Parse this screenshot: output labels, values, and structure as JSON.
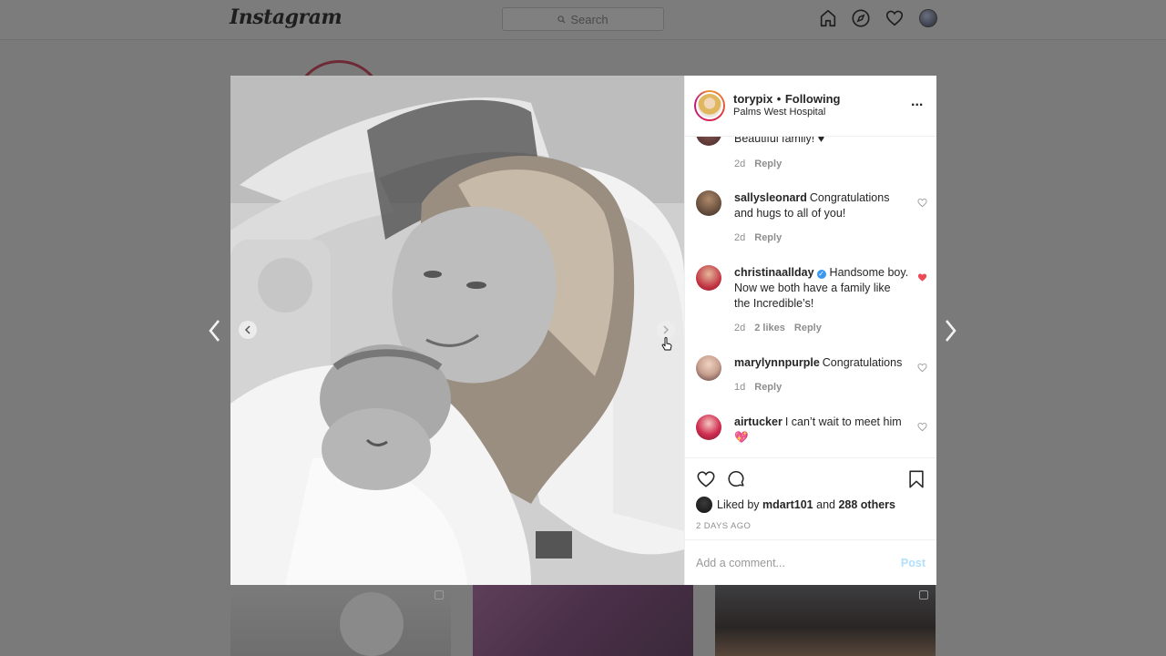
{
  "topbar": {
    "logo": "Instagram",
    "search_placeholder": "Search",
    "icons": [
      "home-icon",
      "explore-compass-icon",
      "activity-heart-icon",
      "profile-avatar"
    ]
  },
  "post": {
    "header": {
      "username": "torypix",
      "separator": "•",
      "follow_status": "Following",
      "location": "Palms West Hospital"
    },
    "comments": [
      {
        "username": "",
        "text": "Beautiful family! ♥",
        "age": "2d",
        "likes": "",
        "reply": "Reply",
        "liked": false
      },
      {
        "username": "sallysleonard",
        "text": "Congratulations and hugs to all of you!",
        "age": "2d",
        "likes": "",
        "reply": "Reply",
        "liked": false
      },
      {
        "username": "christinaallday",
        "verified": true,
        "text": "Handsome boy. Now we both have a family like the Incredible’s!",
        "age": "2d",
        "likes": "2 likes",
        "reply": "Reply",
        "liked": true
      },
      {
        "username": "marylynnpurple",
        "text": "Congratulations",
        "age": "1d",
        "likes": "",
        "reply": "Reply",
        "liked": false
      },
      {
        "username": "airtucker",
        "text": "I can’t wait to meet him 💖",
        "age": "",
        "likes": "",
        "reply": "",
        "liked": false
      }
    ],
    "likes": {
      "prefix": "Liked by",
      "user": "mdart101",
      "conjunction": "and",
      "others": "288 others"
    },
    "timestamp": "2 DAYS AGO",
    "add_comment": {
      "placeholder": "Add a comment...",
      "post_label": "Post"
    }
  },
  "colors": {
    "accent_blue": "#3897f0",
    "post_disabled": "#b2dffc",
    "liked_red": "#ed4956",
    "overlay": "#7a7a7a"
  }
}
